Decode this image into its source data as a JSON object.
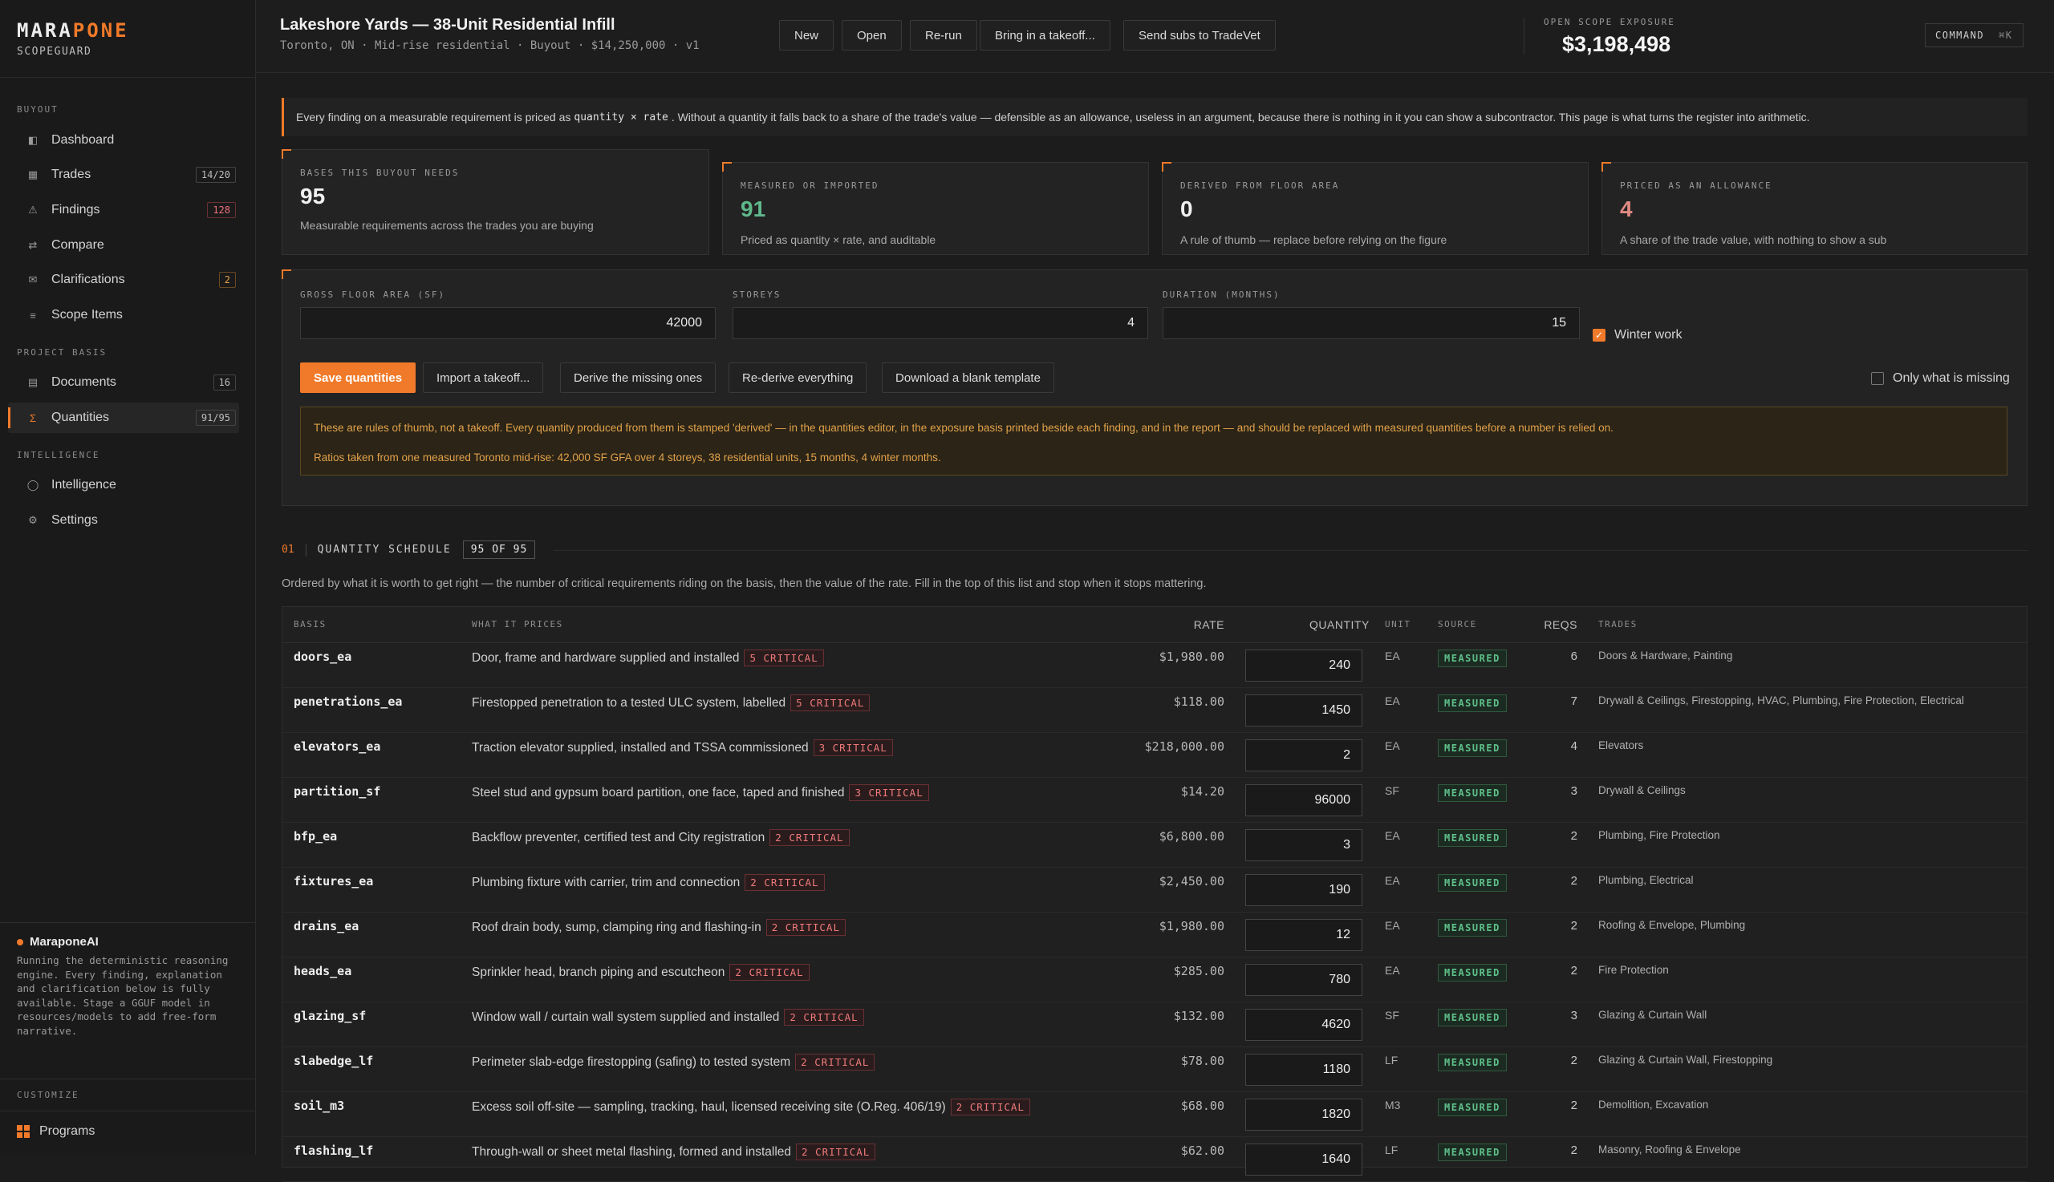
{
  "brand": {
    "name_a": "MARA",
    "name_b": "PONE",
    "subtitle": "SCOPEGUARD"
  },
  "sidebar": {
    "sections": [
      "BUYOUT",
      "PROJECT BASIS",
      "INTELLIGENCE",
      "CUSTOMIZE"
    ],
    "items": [
      {
        "label": "Dashboard",
        "icon": "dashboard-icon",
        "glyph": "◧",
        "badge": ""
      },
      {
        "label": "Trades",
        "icon": "trades-icon",
        "glyph": "▦",
        "badge": "14/20"
      },
      {
        "label": "Findings",
        "icon": "warning-icon",
        "glyph": "⚠",
        "badge": "128"
      },
      {
        "label": "Compare",
        "icon": "compare-icon",
        "glyph": "⇄",
        "badge": ""
      },
      {
        "label": "Clarifications",
        "icon": "mail-icon",
        "glyph": "✉",
        "badge": "2"
      },
      {
        "label": "Scope Items",
        "icon": "list-icon",
        "glyph": "≡",
        "badge": ""
      },
      {
        "label": "Documents",
        "icon": "document-icon",
        "glyph": "▤",
        "badge": "16"
      },
      {
        "label": "Quantities",
        "icon": "sigma-icon",
        "glyph": "Σ",
        "badge": "91/95"
      },
      {
        "label": "Intelligence",
        "icon": "intelligence-icon",
        "glyph": "◯",
        "badge": ""
      },
      {
        "label": "Settings",
        "icon": "gear-icon",
        "glyph": "⚙",
        "badge": ""
      }
    ],
    "ai": {
      "title": "MaraponeAI",
      "text": "Running the deterministic reasoning engine. Every finding, explanation and clarification below is fully available. Stage a GGUF model in resources/models to add free-form narrative."
    },
    "programs_label": "Programs"
  },
  "header": {
    "title": "Lakeshore Yards — 38-Unit Residential Infill",
    "subtitle": "Toronto, ON · Mid-rise residential · Buyout · $14,250,000 · v1",
    "buttons": [
      "New",
      "Open",
      "Re-run",
      "Bring in a takeoff...",
      "Send subs to TradeVet"
    ],
    "exposure_label": "OPEN SCOPE EXPOSURE",
    "exposure_value": "$3,198,498",
    "command_label": "COMMAND",
    "command_key": "⌘K"
  },
  "note": {
    "before": "Every finding on a measurable requirement is priced as",
    "code": "quantity × rate",
    "after": ". Without a quantity it falls back to a share of the trade's value — defensible as an allowance, useless in an argument, because there is nothing in it you can show a subcontractor. This page is what turns the register into arithmetic."
  },
  "stats": [
    {
      "label": "BASES THIS BUYOUT NEEDS",
      "value": "95",
      "desc": "Measurable requirements across the trades you are buying"
    },
    {
      "label": "MEASURED OR IMPORTED",
      "value": "91",
      "desc": "Priced as quantity × rate, and auditable"
    },
    {
      "label": "DERIVED FROM FLOOR AREA",
      "value": "0",
      "desc": "A rule of thumb — replace before relying on the figure"
    },
    {
      "label": "PRICED AS AN ALLOWANCE",
      "value": "4",
      "desc": "A share of the trade value, with nothing to show a sub"
    }
  ],
  "inputs": {
    "gfa_label": "GROSS FLOOR AREA (SF)",
    "gfa_value": "42000",
    "storeys_label": "STOREYS",
    "storeys_value": "4",
    "duration_label": "DURATION (MONTHS)",
    "duration_value": "15",
    "winter_label": "Winter work",
    "missing_label": "Only what is missing"
  },
  "actions": [
    "Save quantities",
    "Import a takeoff...",
    "Derive the missing ones",
    "Re-derive everything",
    "Download a blank template"
  ],
  "warning": {
    "line1": "These are rules of thumb, not a takeoff. Every quantity produced from them is stamped 'derived' — in the quantities editor, in the exposure basis printed beside each finding, and in the report — and should be replaced with measured quantities before a number is relied on.",
    "line2": "Ratios taken from one measured Toronto mid-rise: 42,000 SF GFA over 4 storeys, 38 residential units, 15 months, 4 winter months."
  },
  "schedule": {
    "num": "01",
    "title": "QUANTITY SCHEDULE",
    "count": "95 OF 95",
    "desc": "Ordered by what it is worth to get right — the number of critical requirements riding on the basis, then the value of the rate. Fill in the top of this list and stop when it stops mattering.",
    "columns": {
      "basis": "BASIS",
      "what": "WHAT IT PRICES",
      "rate": "RATE",
      "quantity": "QUANTITY",
      "unit": "UNIT",
      "source": "SOURCE",
      "reqs": "REQS",
      "trades": "TRADES"
    },
    "rows": [
      {
        "basis": "doors_ea",
        "what": "Door, frame and hardware supplied and installed",
        "crit": "5 CRITICAL",
        "rate": "$1,980.00",
        "qty": "240",
        "unit": "EA",
        "source": "MEASURED",
        "reqs": "6",
        "trades": "Doors & Hardware, Painting"
      },
      {
        "basis": "penetrations_ea",
        "what": "Firestopped penetration to a tested ULC system, labelled",
        "crit": "5 CRITICAL",
        "rate": "$118.00",
        "qty": "1450",
        "unit": "EA",
        "source": "MEASURED",
        "reqs": "7",
        "trades": "Drywall & Ceilings, Firestopping, HVAC, Plumbing, Fire Protection, Electrical"
      },
      {
        "basis": "elevators_ea",
        "what": "Traction elevator supplied, installed and TSSA commissioned",
        "crit": "3 CRITICAL",
        "rate": "$218,000.00",
        "qty": "2",
        "unit": "EA",
        "source": "MEASURED",
        "reqs": "4",
        "trades": "Elevators"
      },
      {
        "basis": "partition_sf",
        "what": "Steel stud and gypsum board partition, one face, taped and finished",
        "crit": "3 CRITICAL",
        "rate": "$14.20",
        "qty": "96000",
        "unit": "SF",
        "source": "MEASURED",
        "reqs": "3",
        "trades": "Drywall & Ceilings"
      },
      {
        "basis": "bfp_ea",
        "what": "Backflow preventer, certified test and City registration",
        "crit": "2 CRITICAL",
        "rate": "$6,800.00",
        "qty": "3",
        "unit": "EA",
        "source": "MEASURED",
        "reqs": "2",
        "trades": "Plumbing, Fire Protection"
      },
      {
        "basis": "fixtures_ea",
        "what": "Plumbing fixture with carrier, trim and connection",
        "crit": "2 CRITICAL",
        "rate": "$2,450.00",
        "qty": "190",
        "unit": "EA",
        "source": "MEASURED",
        "reqs": "2",
        "trades": "Plumbing, Electrical"
      },
      {
        "basis": "drains_ea",
        "what": "Roof drain body, sump, clamping ring and flashing-in",
        "crit": "2 CRITICAL",
        "rate": "$1,980.00",
        "qty": "12",
        "unit": "EA",
        "source": "MEASURED",
        "reqs": "2",
        "trades": "Roofing & Envelope, Plumbing"
      },
      {
        "basis": "heads_ea",
        "what": "Sprinkler head, branch piping and escutcheon",
        "crit": "2 CRITICAL",
        "rate": "$285.00",
        "qty": "780",
        "unit": "EA",
        "source": "MEASURED",
        "reqs": "2",
        "trades": "Fire Protection"
      },
      {
        "basis": "glazing_sf",
        "what": "Window wall / curtain wall system supplied and installed",
        "crit": "2 CRITICAL",
        "rate": "$132.00",
        "qty": "4620",
        "unit": "SF",
        "source": "MEASURED",
        "reqs": "3",
        "trades": "Glazing & Curtain Wall"
      },
      {
        "basis": "slabedge_lf",
        "what": "Perimeter slab-edge firestopping (safing) to tested system",
        "crit": "2 CRITICAL",
        "rate": "$78.00",
        "qty": "1180",
        "unit": "LF",
        "source": "MEASURED",
        "reqs": "2",
        "trades": "Glazing & Curtain Wall, Firestopping"
      },
      {
        "basis": "soil_m3",
        "what": "Excess soil off-site — sampling, tracking, haul, licensed receiving site (O.Reg. 406/19)",
        "crit": "2 CRITICAL",
        "rate": "$68.00",
        "qty": "1820",
        "unit": "M3",
        "source": "MEASURED",
        "reqs": "2",
        "trades": "Demolition, Excavation"
      },
      {
        "basis": "flashing_lf",
        "what": "Through-wall or sheet metal flashing, formed and installed",
        "crit": "2 CRITICAL",
        "rate": "$62.00",
        "qty": "1640",
        "unit": "LF",
        "source": "MEASURED",
        "reqs": "2",
        "trades": "Masonry, Roofing & Envelope"
      }
    ]
  }
}
